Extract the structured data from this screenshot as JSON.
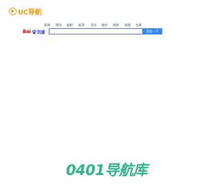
{
  "header": {
    "logo_text": "UC导航",
    "logo_color": "#f39c12"
  },
  "search": {
    "engine_logo_bai": "Bai",
    "engine_logo_du": "百度",
    "tabs": [
      "新闻",
      "网页",
      "贴吧",
      "知道",
      "音乐",
      "图片",
      "视频",
      "地图",
      "文库"
    ],
    "input_value": "",
    "input_placeholder": "",
    "button_label": "百度一下",
    "accent_color": "#3385ff"
  },
  "footer": {
    "logo_text": "0401导航库",
    "logo_color": "#2fb388"
  }
}
